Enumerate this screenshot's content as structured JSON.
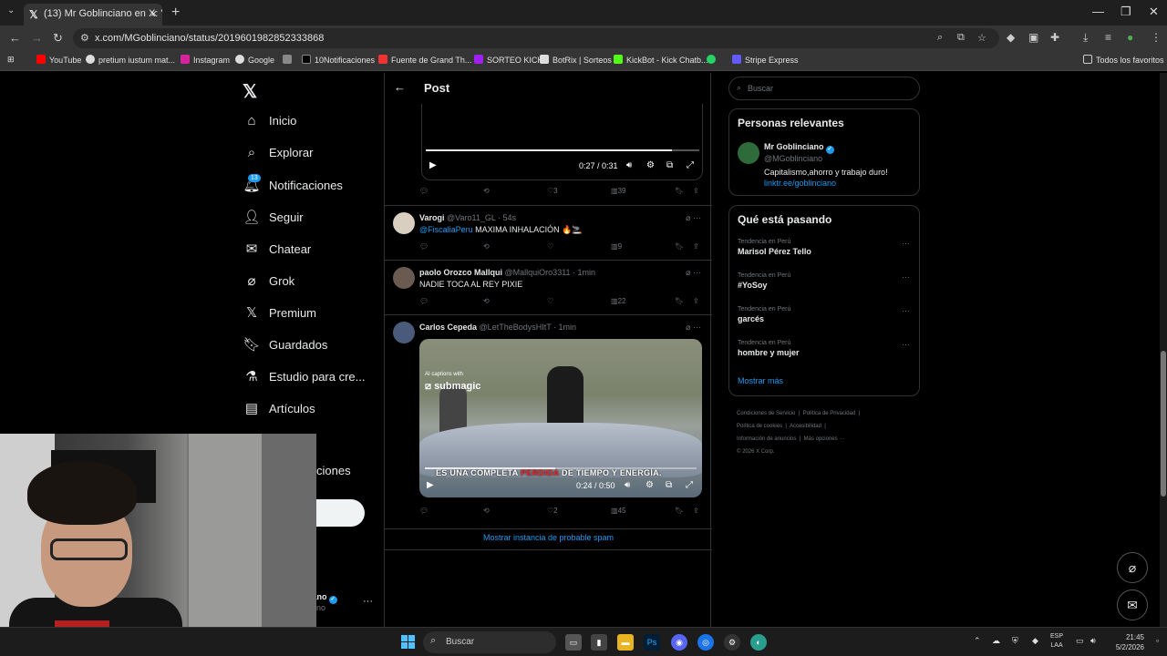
{
  "browser": {
    "tab_title": "(13) Mr Goblinciano en X: \"",
    "url": "x.com/MGoblinciano/status/2019601982852333868",
    "bookmarks": [
      "YouTube",
      "pretium iustum mat...",
      "Instagram",
      "Google",
      "10Notificaciones",
      "Fuente de Grand Th...",
      "SORTEO KICK",
      "BotRix | Sorteos",
      "KickBot - Kick Chatb...",
      "Stripe Express"
    ],
    "all_bookmarks": "Todos los favoritos"
  },
  "sidebar": {
    "items": [
      {
        "label": "Inicio",
        "icon": "home-icon"
      },
      {
        "label": "Explorar",
        "icon": "search-icon"
      },
      {
        "label": "Notificaciones",
        "icon": "bell-icon"
      },
      {
        "label": "Seguir",
        "icon": "follow-icon"
      },
      {
        "label": "Chatear",
        "icon": "mail-icon"
      },
      {
        "label": "Grok",
        "icon": "grok-icon"
      },
      {
        "label": "Premium",
        "icon": "x-icon"
      },
      {
        "label": "Guardados",
        "icon": "bookmark-icon"
      },
      {
        "label": "Estudio para cre...",
        "icon": "flask-icon"
      },
      {
        "label": "Artículos",
        "icon": "article-icon"
      }
    ],
    "notif_count": "13",
    "partial_more": "ciones",
    "profile_name": "iano",
    "profile_handle": "iano"
  },
  "post": {
    "header_title": "Post",
    "video1": {
      "time": "0:27 / 0:31",
      "progress": 0.9
    },
    "stats": {
      "likes": "3",
      "views": "39"
    }
  },
  "replies": [
    {
      "name": "Varogi",
      "handle": "@Varo11_GL · 54s",
      "mention": "@FiscaliaPeru",
      "text": " MAXIMA INHALACIÓN 🔥🚬",
      "views": "9"
    },
    {
      "name": "paolo Orozco Mallqui",
      "handle": "@MallquiOro3311 · 1min",
      "text": "NADIE TOCA AL REY PIXIE",
      "views": "22"
    },
    {
      "name": "Carlos Cepeda",
      "handle": "@LetTheBodysHItT · 1min",
      "video": {
        "brand_small": "AI captions with",
        "brand": "submagic",
        "subtitle_pre": "ES UNA COMPLETA ",
        "subtitle_hl": "PÉRDIDA",
        "subtitle_post": " DE TIEMPO Y ENERGÍA.",
        "time": "0:24 / 0:50",
        "progress": 0.48
      },
      "likes": "2",
      "views": "45"
    }
  ],
  "spam_link": "Mostrar instancia de probable spam",
  "right": {
    "search_placeholder": "Buscar",
    "relevant_title": "Personas relevantes",
    "relevant": {
      "name": "Mr Goblinciano",
      "handle": "@MGoblinciano",
      "bio": "Capitalismo,ahorro y trabajo duro!",
      "link": "linktr.ee/goblinciano"
    },
    "trends_title": "Qué está pasando",
    "trends": [
      {
        "context": "Tendencia en Perú",
        "name": "Marisol Pérez Tello"
      },
      {
        "context": "Tendencia en Perú",
        "name": "#YoSoy"
      },
      {
        "context": "Tendencia en Perú",
        "name": "garcés"
      },
      {
        "context": "Tendencia en Perú",
        "name": "hombre y mujer"
      }
    ],
    "show_more": "Mostrar más",
    "footer": {
      "line1": [
        "Condiciones de Servicio",
        "Política de Privacidad"
      ],
      "line2": [
        "Política de cookies",
        "Accesibilidad"
      ],
      "line3": [
        "Información de anuncios",
        "Más opciones ···"
      ],
      "copyright": "© 2026 X Corp."
    }
  },
  "taskbar": {
    "search": "Buscar",
    "lang1": "ESP",
    "lang2": "LAA",
    "time": "21:45",
    "date": "5/2/2026"
  }
}
